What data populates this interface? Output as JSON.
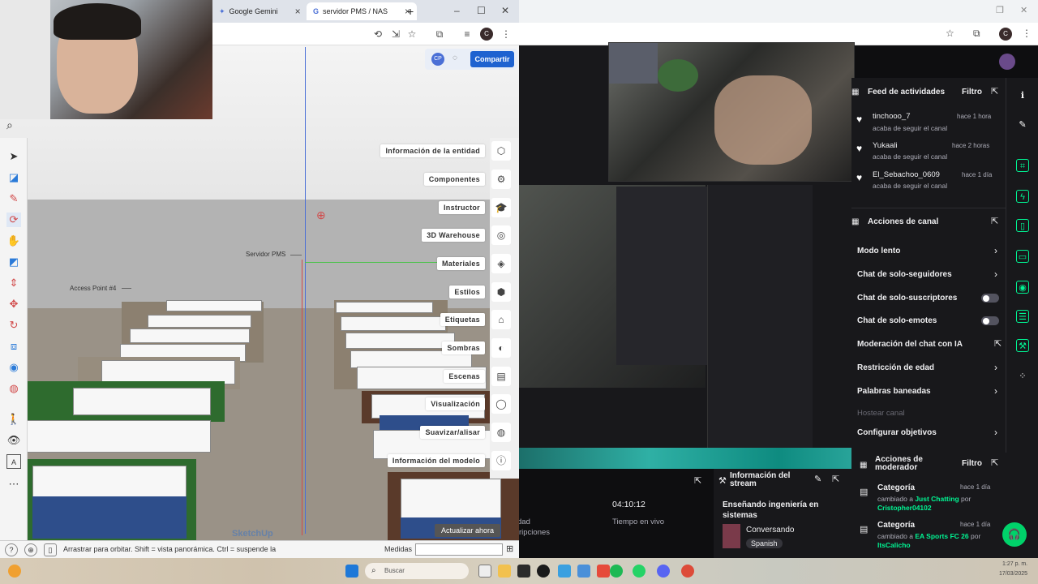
{
  "browser": {
    "tabs": [
      {
        "label": "Google Gemini"
      },
      {
        "label": "servidor PMS / NAS"
      }
    ]
  },
  "sketchup": {
    "share": {
      "avatar": "CP",
      "label": "Compartir"
    },
    "tray": [
      {
        "label": "Información de la entidad",
        "icon": "⬡"
      },
      {
        "label": "Componentes",
        "icon": "⚙"
      },
      {
        "label": "Instructor",
        "icon": "🎓"
      },
      {
        "label": "3D Warehouse",
        "icon": "◎"
      },
      {
        "label": "Materiales",
        "icon": "◈"
      },
      {
        "label": "Estilos",
        "icon": "⬢"
      },
      {
        "label": "Etiquetas",
        "icon": "⌂"
      },
      {
        "label": "Sombras",
        "icon": "◐"
      },
      {
        "label": "Escenas",
        "icon": "▤"
      },
      {
        "label": "Visualización",
        "icon": "◯"
      },
      {
        "label": "Suavizar/alisar",
        "icon": "◍"
      },
      {
        "label": "Información del modelo",
        "icon": "ⓘ"
      }
    ],
    "model_tags": {
      "server": "Servidor PMS",
      "access_point": "Access Point #4"
    },
    "update": "Actualizar ahora",
    "watermark": "SketchUp",
    "status": "Arrastrar para orbitar. Shift = vista panorámica. Ctrl = suspende la",
    "measure_label": "Medidas"
  },
  "twitch": {
    "feed": {
      "title": "Feed de actividades",
      "filter": "Filtro",
      "items": [
        {
          "name": "tinchooo_7",
          "action": "acaba de seguir el canal",
          "time": "hace 1 hora"
        },
        {
          "name": "Yukaali",
          "action": "acaba de seguir el canal",
          "time": "hace 2 horas"
        },
        {
          "name": "El_Sebachoo_0609",
          "action": "acaba de seguir el canal",
          "time": "hace 1 día"
        }
      ]
    },
    "channel_actions": {
      "title": "Acciones de canal",
      "items": [
        {
          "label": "Modo lento",
          "kind": "chevron"
        },
        {
          "label": "Chat de solo-seguidores",
          "kind": "chevron"
        },
        {
          "label": "Chat de solo-suscriptores",
          "kind": "toggle"
        },
        {
          "label": "Chat de solo-emotes",
          "kind": "toggle"
        },
        {
          "label": "Moderación del chat con IA",
          "kind": "external"
        },
        {
          "label": "Restricción de edad",
          "kind": "chevron"
        },
        {
          "label": "Palabras baneadas",
          "kind": "chevron"
        }
      ],
      "disabled": "Hostear canal",
      "goals": "Configurar objetivos"
    },
    "mod_actions": {
      "title": "Acciones de moderador",
      "filter": "Filtro",
      "items": [
        {
          "title": "Categoría",
          "prefix": "cambiado a",
          "value": "Just Chatting",
          "by": "por",
          "user": "Cristopher04102",
          "time": "hace 1 día"
        },
        {
          "title": "Categoría",
          "prefix": "cambiado a",
          "value": "EA Sports FC 26",
          "by": "por",
          "user": "ItsCalicho",
          "time": "hace 1 día"
        }
      ]
    },
    "stream_info": {
      "title": "Información del stream",
      "stream_title": "Enseñando ingeniería en sistemas",
      "category": "Conversando",
      "language": "Spanish"
    },
    "stats": {
      "uptime": "04:10:12",
      "uptime_label": "Tiempo en vivo",
      "partial1": "dad",
      "partial2": "ripciones"
    }
  },
  "taskbar": {
    "search": "Buscar",
    "time": "1:27 p. m.",
    "date": "17/03/2025"
  }
}
